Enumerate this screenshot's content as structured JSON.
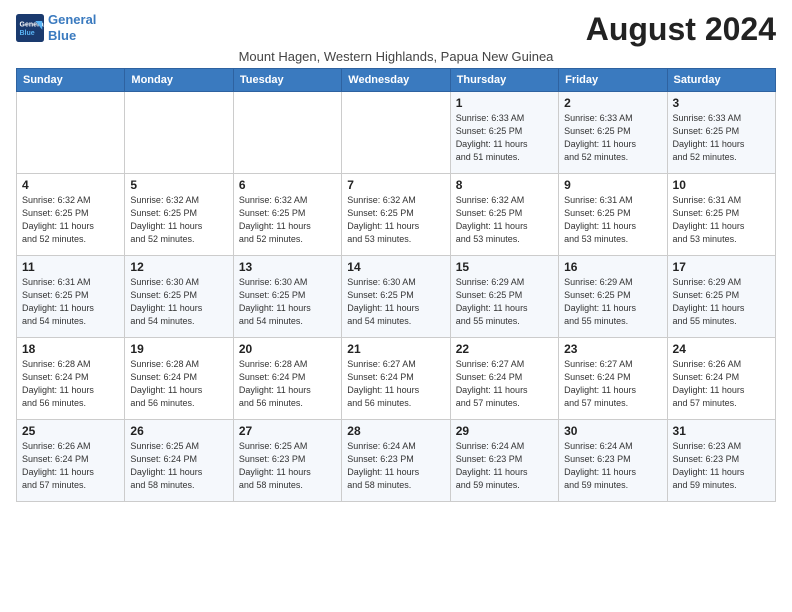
{
  "logo": {
    "line1": "General",
    "line2": "Blue"
  },
  "title": "August 2024",
  "subtitle": "Mount Hagen, Western Highlands, Papua New Guinea",
  "columns": [
    "Sunday",
    "Monday",
    "Tuesday",
    "Wednesday",
    "Thursday",
    "Friday",
    "Saturday"
  ],
  "weeks": [
    [
      {
        "day": "",
        "detail": ""
      },
      {
        "day": "",
        "detail": ""
      },
      {
        "day": "",
        "detail": ""
      },
      {
        "day": "",
        "detail": ""
      },
      {
        "day": "1",
        "detail": "Sunrise: 6:33 AM\nSunset: 6:25 PM\nDaylight: 11 hours\nand 51 minutes."
      },
      {
        "day": "2",
        "detail": "Sunrise: 6:33 AM\nSunset: 6:25 PM\nDaylight: 11 hours\nand 52 minutes."
      },
      {
        "day": "3",
        "detail": "Sunrise: 6:33 AM\nSunset: 6:25 PM\nDaylight: 11 hours\nand 52 minutes."
      }
    ],
    [
      {
        "day": "4",
        "detail": "Sunrise: 6:32 AM\nSunset: 6:25 PM\nDaylight: 11 hours\nand 52 minutes."
      },
      {
        "day": "5",
        "detail": "Sunrise: 6:32 AM\nSunset: 6:25 PM\nDaylight: 11 hours\nand 52 minutes."
      },
      {
        "day": "6",
        "detail": "Sunrise: 6:32 AM\nSunset: 6:25 PM\nDaylight: 11 hours\nand 52 minutes."
      },
      {
        "day": "7",
        "detail": "Sunrise: 6:32 AM\nSunset: 6:25 PM\nDaylight: 11 hours\nand 53 minutes."
      },
      {
        "day": "8",
        "detail": "Sunrise: 6:32 AM\nSunset: 6:25 PM\nDaylight: 11 hours\nand 53 minutes."
      },
      {
        "day": "9",
        "detail": "Sunrise: 6:31 AM\nSunset: 6:25 PM\nDaylight: 11 hours\nand 53 minutes."
      },
      {
        "day": "10",
        "detail": "Sunrise: 6:31 AM\nSunset: 6:25 PM\nDaylight: 11 hours\nand 53 minutes."
      }
    ],
    [
      {
        "day": "11",
        "detail": "Sunrise: 6:31 AM\nSunset: 6:25 PM\nDaylight: 11 hours\nand 54 minutes."
      },
      {
        "day": "12",
        "detail": "Sunrise: 6:30 AM\nSunset: 6:25 PM\nDaylight: 11 hours\nand 54 minutes."
      },
      {
        "day": "13",
        "detail": "Sunrise: 6:30 AM\nSunset: 6:25 PM\nDaylight: 11 hours\nand 54 minutes."
      },
      {
        "day": "14",
        "detail": "Sunrise: 6:30 AM\nSunset: 6:25 PM\nDaylight: 11 hours\nand 54 minutes."
      },
      {
        "day": "15",
        "detail": "Sunrise: 6:29 AM\nSunset: 6:25 PM\nDaylight: 11 hours\nand 55 minutes."
      },
      {
        "day": "16",
        "detail": "Sunrise: 6:29 AM\nSunset: 6:25 PM\nDaylight: 11 hours\nand 55 minutes."
      },
      {
        "day": "17",
        "detail": "Sunrise: 6:29 AM\nSunset: 6:25 PM\nDaylight: 11 hours\nand 55 minutes."
      }
    ],
    [
      {
        "day": "18",
        "detail": "Sunrise: 6:28 AM\nSunset: 6:24 PM\nDaylight: 11 hours\nand 56 minutes."
      },
      {
        "day": "19",
        "detail": "Sunrise: 6:28 AM\nSunset: 6:24 PM\nDaylight: 11 hours\nand 56 minutes."
      },
      {
        "day": "20",
        "detail": "Sunrise: 6:28 AM\nSunset: 6:24 PM\nDaylight: 11 hours\nand 56 minutes."
      },
      {
        "day": "21",
        "detail": "Sunrise: 6:27 AM\nSunset: 6:24 PM\nDaylight: 11 hours\nand 56 minutes."
      },
      {
        "day": "22",
        "detail": "Sunrise: 6:27 AM\nSunset: 6:24 PM\nDaylight: 11 hours\nand 57 minutes."
      },
      {
        "day": "23",
        "detail": "Sunrise: 6:27 AM\nSunset: 6:24 PM\nDaylight: 11 hours\nand 57 minutes."
      },
      {
        "day": "24",
        "detail": "Sunrise: 6:26 AM\nSunset: 6:24 PM\nDaylight: 11 hours\nand 57 minutes."
      }
    ],
    [
      {
        "day": "25",
        "detail": "Sunrise: 6:26 AM\nSunset: 6:24 PM\nDaylight: 11 hours\nand 57 minutes."
      },
      {
        "day": "26",
        "detail": "Sunrise: 6:25 AM\nSunset: 6:24 PM\nDaylight: 11 hours\nand 58 minutes."
      },
      {
        "day": "27",
        "detail": "Sunrise: 6:25 AM\nSunset: 6:23 PM\nDaylight: 11 hours\nand 58 minutes."
      },
      {
        "day": "28",
        "detail": "Sunrise: 6:24 AM\nSunset: 6:23 PM\nDaylight: 11 hours\nand 58 minutes."
      },
      {
        "day": "29",
        "detail": "Sunrise: 6:24 AM\nSunset: 6:23 PM\nDaylight: 11 hours\nand 59 minutes."
      },
      {
        "day": "30",
        "detail": "Sunrise: 6:24 AM\nSunset: 6:23 PM\nDaylight: 11 hours\nand 59 minutes."
      },
      {
        "day": "31",
        "detail": "Sunrise: 6:23 AM\nSunset: 6:23 PM\nDaylight: 11 hours\nand 59 minutes."
      }
    ]
  ]
}
